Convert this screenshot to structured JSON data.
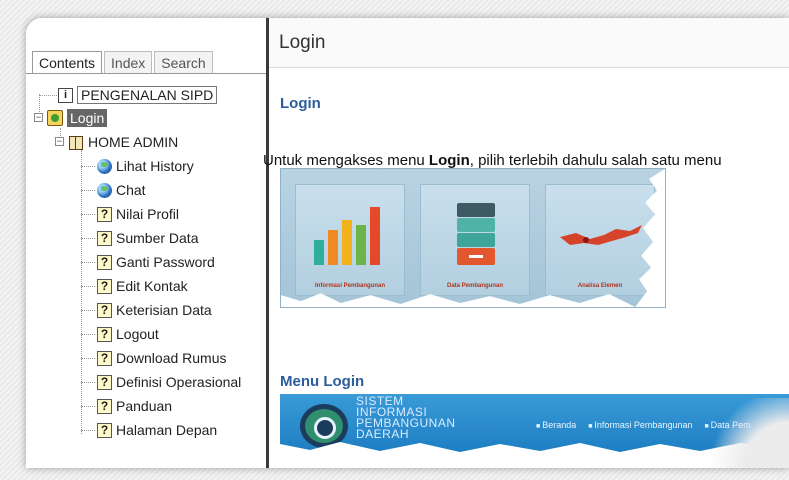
{
  "tabs": [
    "Contents",
    "Index",
    "Search"
  ],
  "tree": {
    "root": "PENGENALAN SIPD",
    "login": "Login",
    "home_admin": "HOME ADMIN",
    "items": [
      {
        "label": "Lihat History",
        "icon": "globe-icon"
      },
      {
        "label": "Chat",
        "icon": "globe-icon"
      },
      {
        "label": "Nilai Profil",
        "icon": "help-page-icon"
      },
      {
        "label": "Sumber Data",
        "icon": "help-page-icon"
      },
      {
        "label": "Ganti Password",
        "icon": "help-page-icon"
      },
      {
        "label": "Edit Kontak",
        "icon": "help-page-icon"
      },
      {
        "label": "Keterisian Data",
        "icon": "help-page-icon"
      },
      {
        "label": "Logout",
        "icon": "help-page-icon"
      },
      {
        "label": "Download Rumus",
        "icon": "help-page-icon"
      },
      {
        "label": "Definisi Operasional",
        "icon": "help-page-icon"
      },
      {
        "label": "Panduan",
        "icon": "help-page-icon"
      },
      {
        "label": "Halaman Depan",
        "icon": "help-page-icon"
      }
    ]
  },
  "page": {
    "header": "Login",
    "section_title": "Login",
    "intro_prefix": "Untuk mengakses menu ",
    "intro_bold": "Login",
    "intro_suffix": ", pilih terlebih dahulu salah satu menu",
    "cards": [
      "Informasi Pembangunan",
      "Data Pembangunan",
      "Analisa Elemen"
    ],
    "menu_title": "Menu Login",
    "logo_text": [
      "SISTEM",
      "INFORMASI",
      "PEMBANGUNAN",
      "DAERAH"
    ],
    "nav": [
      "Beranda",
      "Informasi Pembangunan",
      "Data Pem"
    ]
  },
  "colors": {
    "accent": "#2b5d9c",
    "card_caption": "#b0361d",
    "navbar": "#1d7dc2"
  }
}
